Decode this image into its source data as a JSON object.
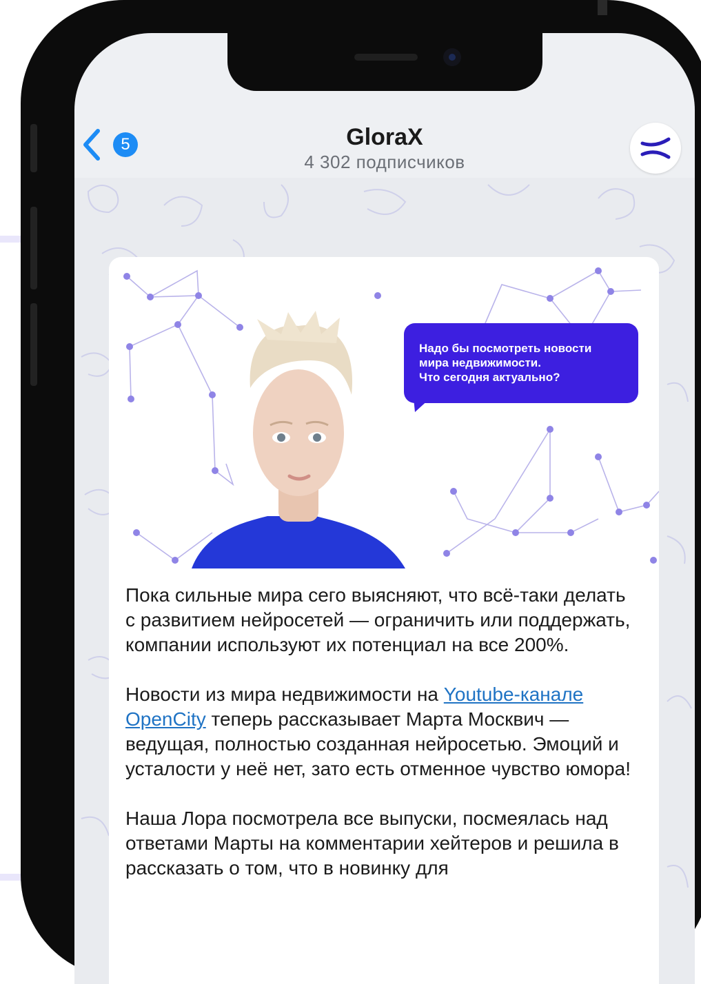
{
  "header": {
    "back_count": "5",
    "title": "GloraX",
    "subtitle": "4 302 подписчиков",
    "avatar_icon": "glorax-logo-icon"
  },
  "media": {
    "speech_line1": "Надо бы посмотреть новости",
    "speech_line2": "мира недвижимости.",
    "speech_line3": "Что сегодня актуально?",
    "accent_color": "#3d1fe0"
  },
  "message": {
    "p1": "Пока сильные мира сего выясняют, что всё-таки делать с развитием нейросетей — ограничить или поддержать, компании используют их потенциал на все 200%.",
    "p2_before": "Новости из мира недвижимости на ",
    "p2_link": "Youtube-канале OpenCity",
    "p2_after": " теперь рассказывает Марта Москвич — ведущая, полностью созданная нейросетью. Эмоций и усталости у неё нет, зато есть отменное чувство юмора!",
    "p3": "Наша Лора посмотрела все выпуски, посмеялась над ответами Марты на комментарии хейтеров и решила в рассказать о том, что в новинку для"
  }
}
